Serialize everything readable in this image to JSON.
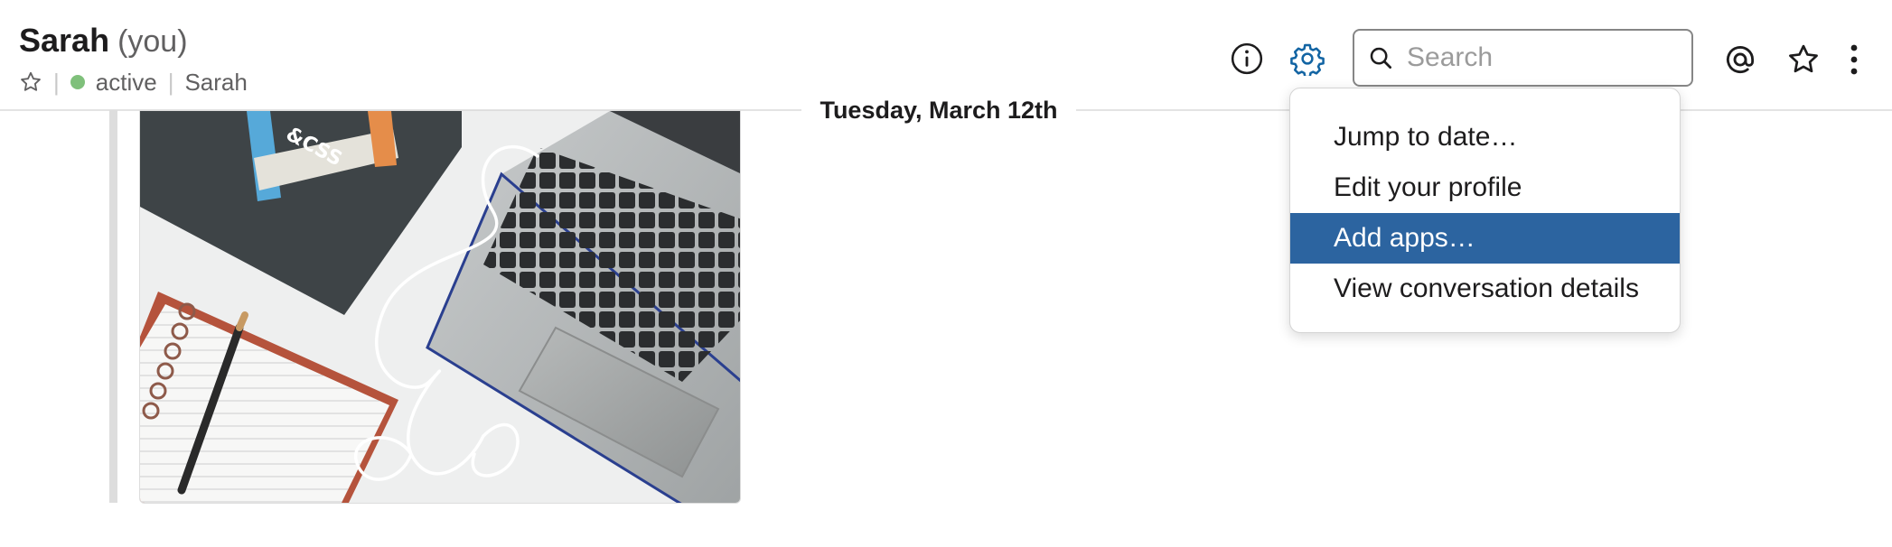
{
  "header": {
    "name": "Sarah",
    "you_label": "(you)",
    "status": "active",
    "display_name": "Sarah",
    "meta_separator": "|"
  },
  "icons": {
    "star_outline": "star-icon",
    "info": "info-icon",
    "settings": "gear-icon",
    "search": "search-icon",
    "mentions": "at-icon",
    "saved": "star-icon",
    "more": "more-vertical-icon"
  },
  "search": {
    "placeholder": "Search",
    "value": ""
  },
  "date_divider": "Tuesday, March 12th",
  "message": {
    "image_alt": "Laptop, HTML & CSS book, notebook and earphones on a desk"
  },
  "settings_menu": {
    "items": [
      {
        "label": "Jump to date…",
        "highlighted": false
      },
      {
        "label": "Edit your profile",
        "highlighted": false
      },
      {
        "label": "Add apps…",
        "highlighted": true
      },
      {
        "label": "View conversation details",
        "highlighted": false
      }
    ]
  },
  "colors": {
    "accent": "#2c64a0",
    "settings_icon": "#1264a3",
    "presence": "#7fc07b",
    "text_primary": "#1d1c1d",
    "text_secondary": "#616061"
  }
}
